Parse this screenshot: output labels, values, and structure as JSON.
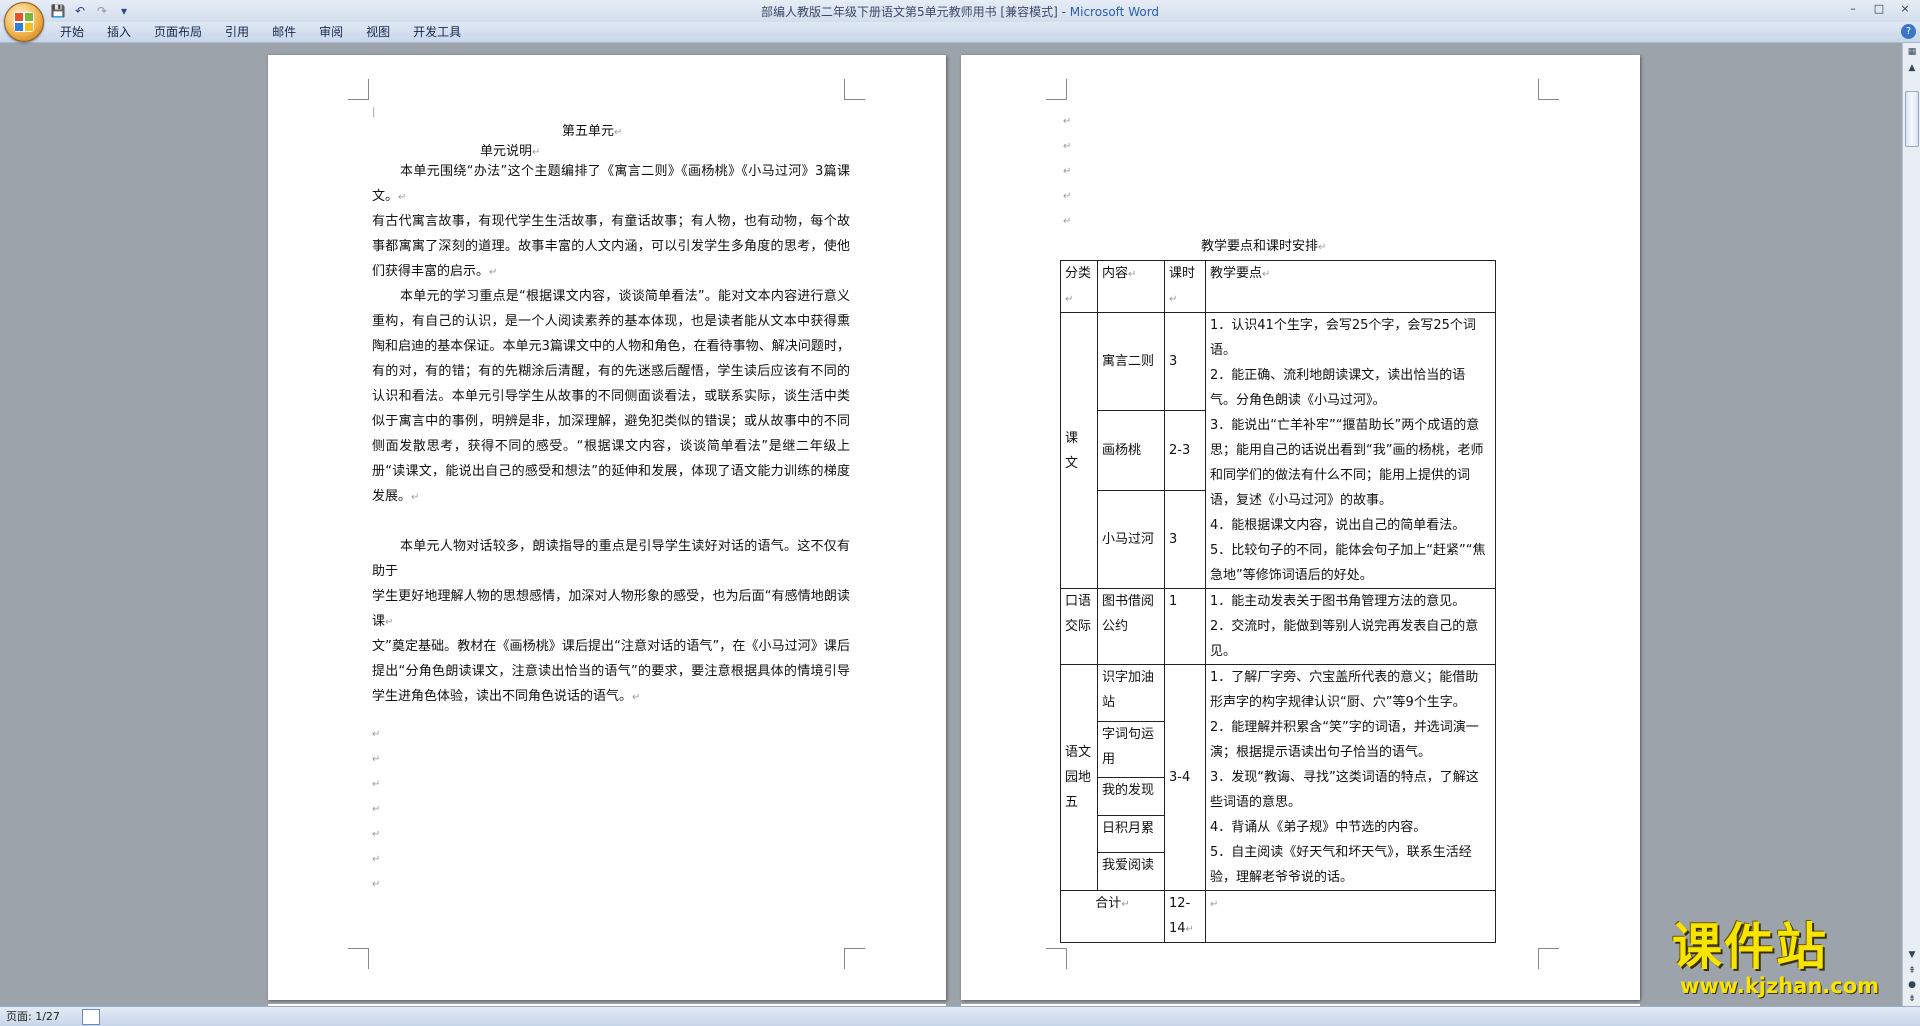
{
  "window": {
    "title": "部编人教版二年级下册语文第5单元教师用书 [兼容模式]",
    "app_name": "Microsoft Word",
    "controls": [
      "–",
      "□",
      "×"
    ]
  },
  "quick_access": {
    "icons": [
      "save-icon",
      "undo-icon",
      "redo-icon",
      "customize-icon"
    ]
  },
  "ribbon": {
    "tabs": [
      "开始",
      "插入",
      "页面布局",
      "引用",
      "邮件",
      "审阅",
      "视图",
      "开发工具"
    ]
  },
  "page_left": {
    "title": "第五单元",
    "subtitle": "单元说明",
    "paragraphs": [
      "本单元围绕“办法”这个主题编排了《寓言二则》《画杨桃》《小马过河》3篇课文。",
      "有古代寓言故事，有现代学生生活故事，有童话故事；有人物，也有动物，每个故事都寓寓了深刻的道理。故事丰富的人文内涵，可以引发学生多角度的思考，使他们获得丰富的启示。",
      "本单元的学习重点是“根据课文内容，谈谈简单看法”。能对文本内容进行意义重构，有自己的认识，是一个人阅读素养的基本体现，也是读者能从文本中获得熏陶和启迪的基本保证。本单元3篇课文中的人物和角色，在看待事物、解决问题时，有的对，有的错；有的先糊涂后清醒，有的先迷惑后醒悟，学生读后应该有不同的认识和看法。本单元引导学生从故事的不同侧面谈看法，或联系实际，谈生活中类似于寓言中的事例，明辨是非，加深理解，避免犯类似的错误；或从故事中的不同侧面发散思考，获得不同的感受。“根据课文内容，谈谈简单看法”是继二年级上册“读课文，能说出自己的感受和想法”的延伸和发展，体现了语文能力训练的梯度发展。",
      "本单元人物对话较多，朗读指导的重点是引导学生读好对话的语气。这不仅有助于",
      "学生更好地理解人物的思想感情，加深对人物形象的感受，也为后面“有感情地朗读课",
      "文”奠定基础。教材在《画杨桃》课后提出“注意对话的语气”，在《小马过河》课后提出“分角色朗读课文，注意读出恰当的语气”的要求，要注意根据具体的情境引导学生进角色体验，读出不同角色说话的语气。"
    ]
  },
  "page_right": {
    "table_title": "教学要点和课时安排",
    "headers": [
      "分类",
      "内容",
      "课时",
      "教学要点"
    ],
    "groups": {
      "kewen": {
        "category": "课文",
        "rows": [
          {
            "content": "寓言二则",
            "hours": "3"
          },
          {
            "content": "画杨桃",
            "hours": "2-3"
          },
          {
            "content": "小马过河",
            "hours": "3"
          }
        ],
        "points": [
          "1．认识41个生字，会写25个字，会写25个词语。",
          "2．能正确、流利地朗读课文，读出恰当的语气。分角色朗读《小马过河》。",
          "3．能说出“亡羊补牢”“揠苗助长”两个成语的意思；能用自己的话说出看到“我”画的杨桃，老师和同学们的做法有什么不同；能用上提供的词语，复述《小马过河》的故事。",
          "4．能根据课文内容，说出自己的简单看法。",
          "5．比较句子的不同，能体会句子加上“赶紧”“焦急地”等修饰词语后的好处。"
        ]
      },
      "koujiao": {
        "category": "口语交际",
        "content": "图书借阅公约",
        "hours": "1",
        "points": [
          "1．能主动发表关于图书角管理方法的意见。",
          "2．交流时，能做到等别人说完再发表自己的意见。"
        ]
      },
      "yuwen": {
        "category": "语文园地五",
        "hours": "3-4",
        "items": [
          "识字加油站",
          "字词句运用",
          "我的发现",
          "日积月累",
          "我爱阅读"
        ],
        "points": [
          "1．了解厂字旁、穴宝盖所代表的意义；能借助形声字的构字规律认识“厨、穴”等9个生字。",
          "2．能理解并积累含“笑”字的词语，并选词演一演；根据提示语读出句子恰当的语气。",
          "3．发现“教诲、寻找”这类词语的特点，了解这些词语的意思。",
          "4．背诵从《弟子规》中节选的内容。",
          "5．自主阅读《好天气和坏天气》，联系生活经验，理解老爷爷说的话。"
        ]
      }
    },
    "total_label": "合计",
    "total_hours": "12-14"
  },
  "status": {
    "page_indicator": "页面: 1/27"
  },
  "watermark": {
    "title": "课件站",
    "url": "www.kjzhan.com"
  }
}
